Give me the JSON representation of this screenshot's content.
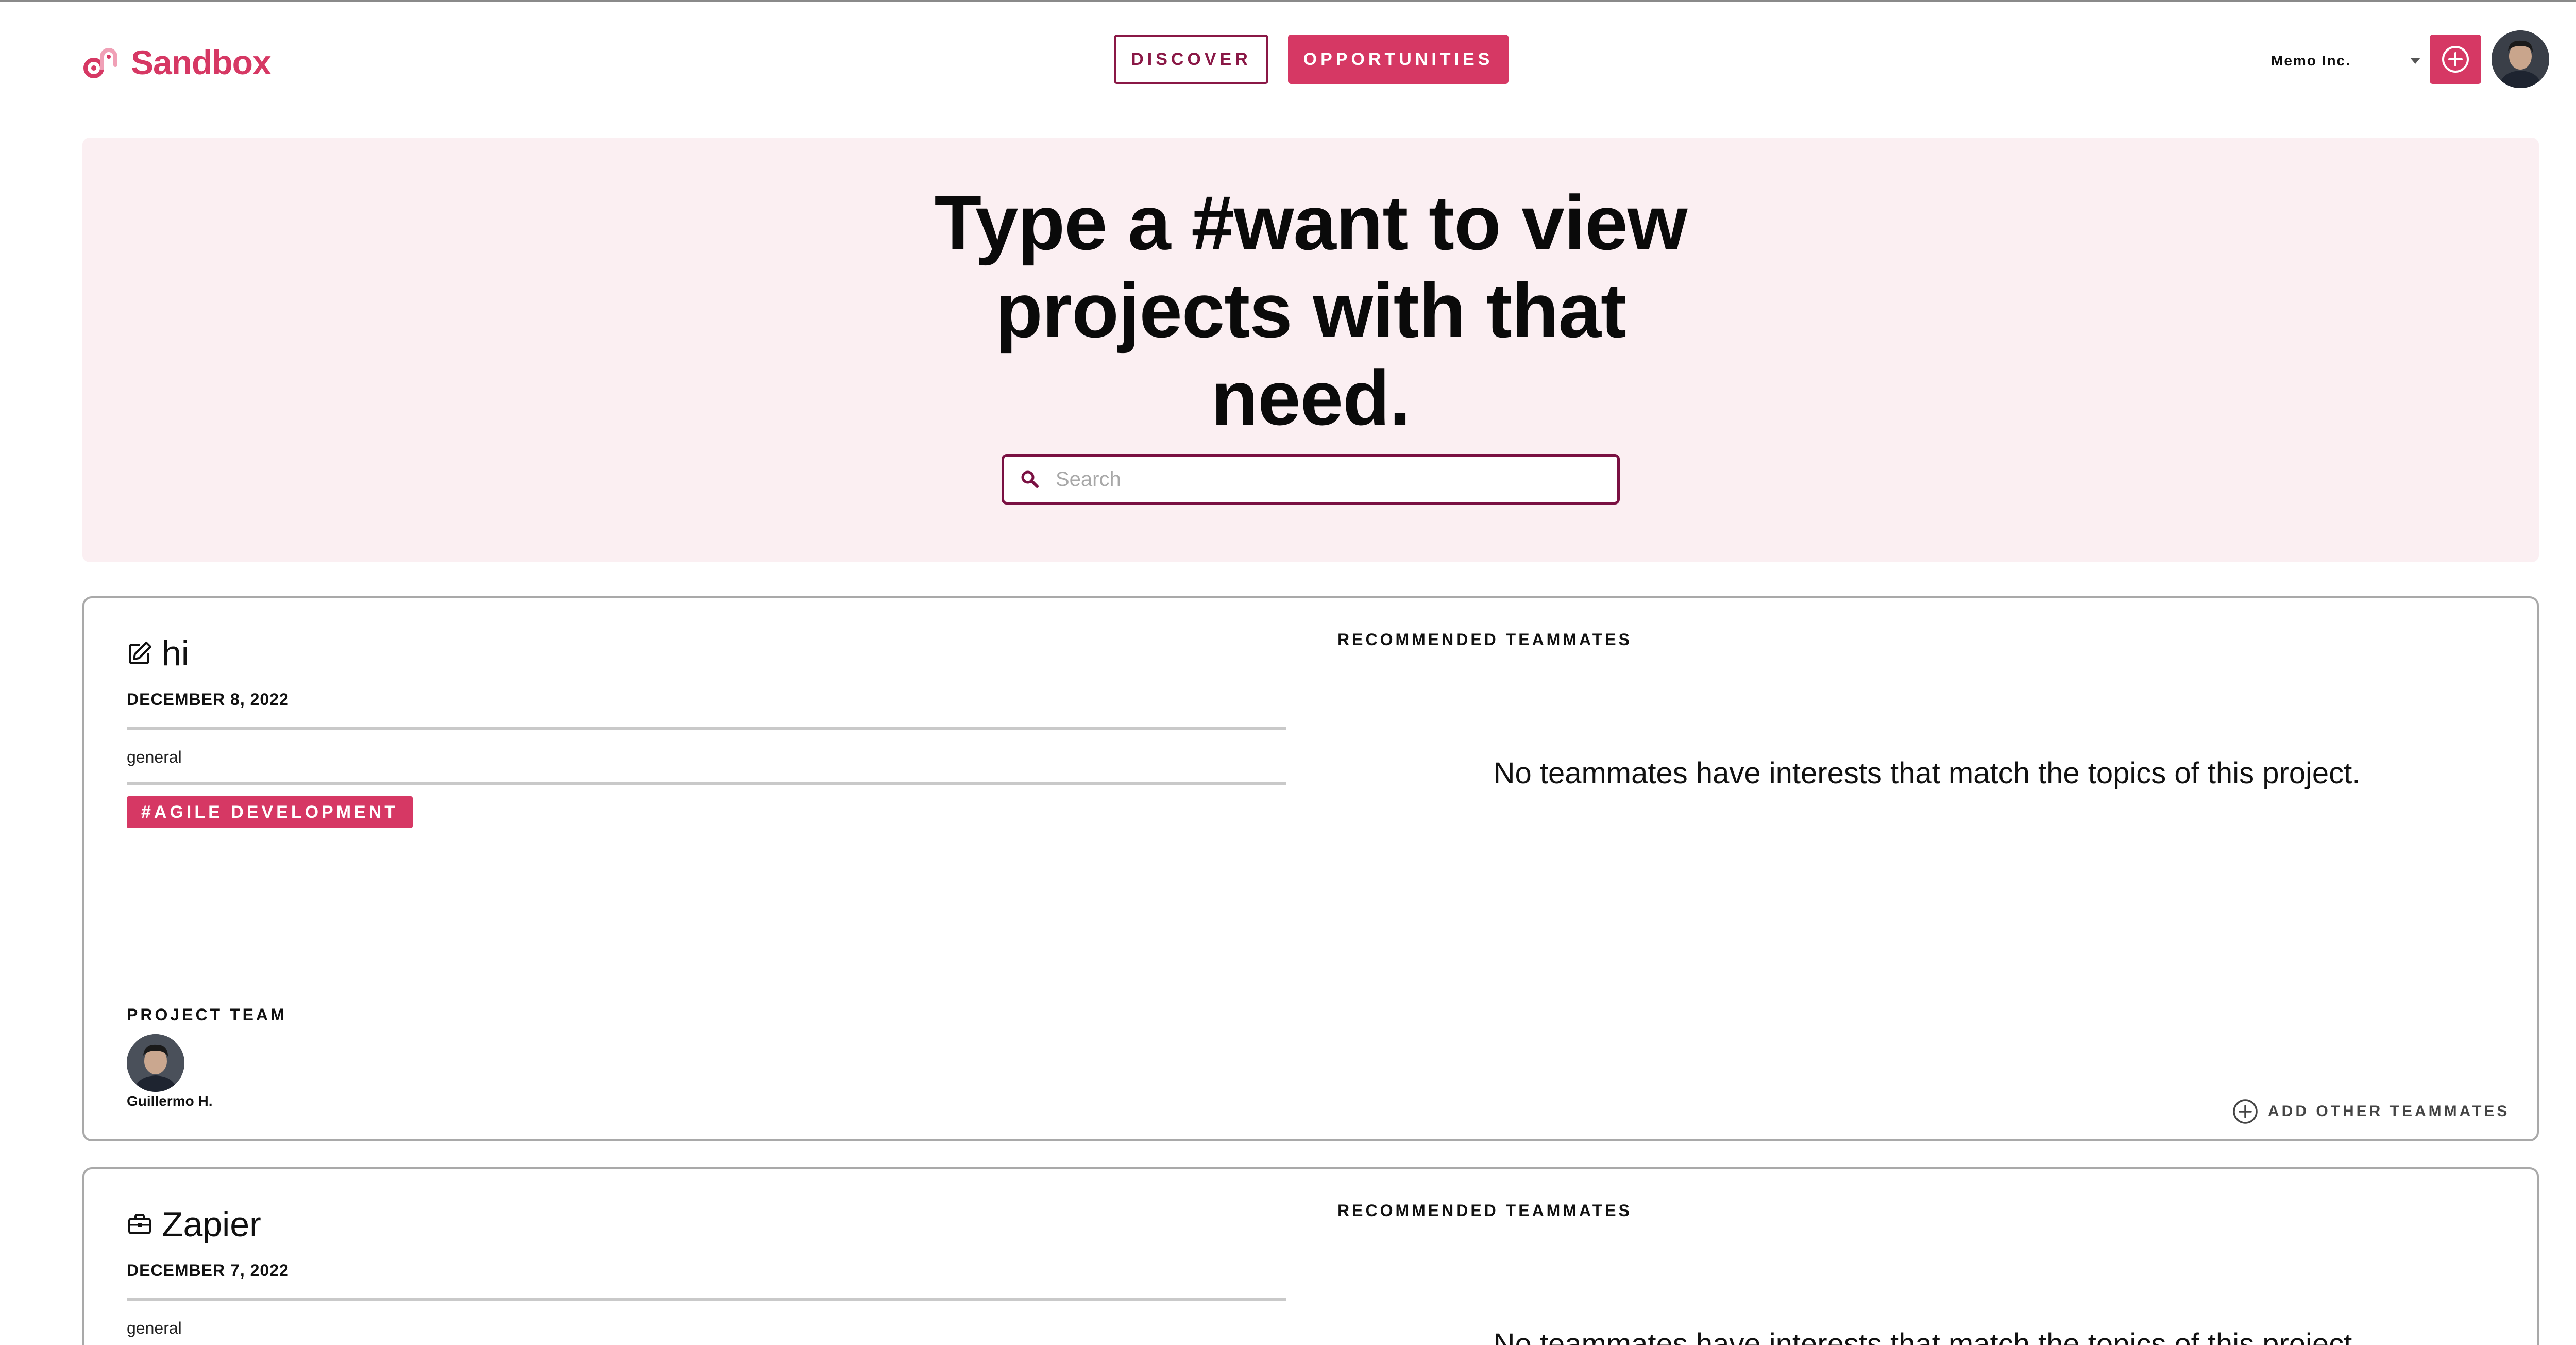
{
  "app": {
    "brand": "Sandbox",
    "brand_color": "#d63864"
  },
  "nav": {
    "discover_label": "DISCOVER",
    "opportunities_label": "OPPORTUNITIES"
  },
  "account": {
    "org_name": "Memo Inc.",
    "add_icon": "plus-circle-icon",
    "avatar": "user-avatar"
  },
  "hero": {
    "title": "Type a #want to view projects with that need.",
    "search_placeholder": "Search",
    "search_value": "",
    "background_color": "#fbeff2"
  },
  "projects": [
    {
      "icon": "edit-icon",
      "name": "hi",
      "date": "DECEMBER 8, 2022",
      "category": "general",
      "tags": [
        "#AGILE DEVELOPMENT"
      ],
      "team_label": "PROJECT TEAM",
      "team": [
        {
          "name": "Guillermo H."
        }
      ],
      "recommended_label": "RECOMMENDED TEAMMATES",
      "recommended_empty": "No teammates have interests that match the topics of this project.",
      "add_teammates_label": "ADD OTHER TEAMMATES"
    },
    {
      "icon": "briefcase-icon",
      "name": "Zapier",
      "date": "DECEMBER 7, 2022",
      "category": "general",
      "recommended_label": "RECOMMENDED TEAMMATES",
      "recommended_empty": "No teammates have interests that match the topics of this project."
    }
  ]
}
